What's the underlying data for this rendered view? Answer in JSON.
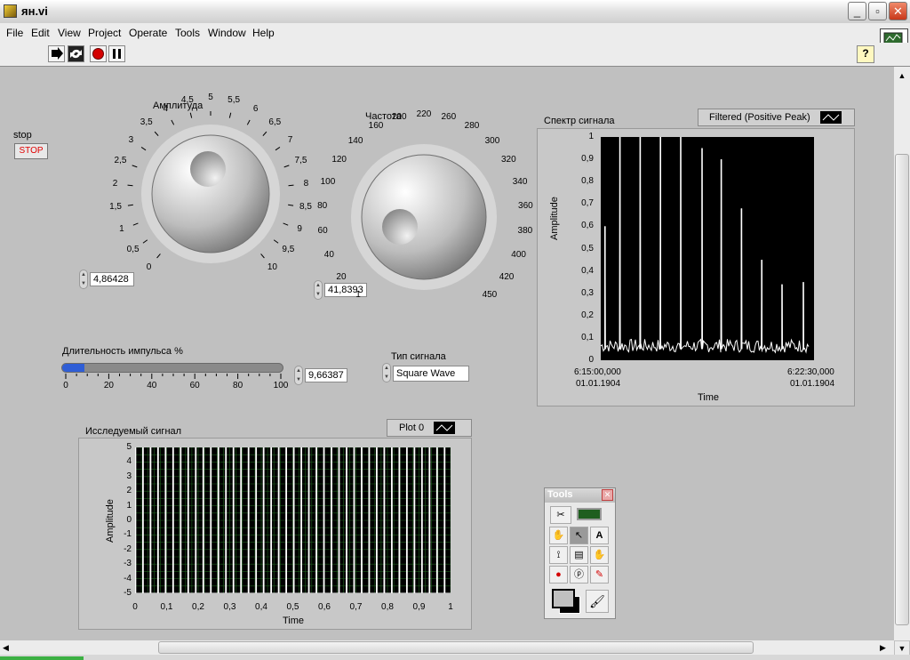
{
  "window": {
    "title": "ян.vi",
    "min_label": "_",
    "max_label": "▫",
    "close_label": "✕"
  },
  "menu": [
    "File",
    "Edit",
    "View",
    "Project",
    "Operate",
    "Tools",
    "Window",
    "Help"
  ],
  "help_label": "?",
  "stop": {
    "label": "stop",
    "button": "STOP"
  },
  "amplitude": {
    "label": "Амплитуда",
    "value": "4,86428",
    "scale": [
      "0",
      "0,5",
      "1",
      "1,5",
      "2",
      "2,5",
      "3",
      "3,5",
      "4",
      "4,5",
      "5",
      "5,5",
      "6",
      "6,5",
      "7",
      "7,5",
      "8",
      "8,5",
      "9",
      "9,5",
      "10"
    ]
  },
  "frequency": {
    "label": "Частота",
    "value": "41,8393",
    "scale": [
      "1",
      "20",
      "40",
      "60",
      "80",
      "100",
      "120",
      "140",
      "160",
      "200",
      "220",
      "260",
      "280",
      "300",
      "320",
      "340",
      "360",
      "380",
      "400",
      "420",
      "450"
    ]
  },
  "pulse": {
    "label": "Длительность импульса %",
    "value": "9,66387",
    "fill": 0.1,
    "ticks": [
      "0",
      "20",
      "40",
      "60",
      "80",
      "100"
    ]
  },
  "signal_type": {
    "label": "Тип сигнала",
    "value": "Square Wave"
  },
  "spectrum": {
    "label": "Спектр сигнала",
    "legend": "Filtered (Positive Peak)",
    "ylabel": "Amplitude",
    "xlabel": "Time",
    "yticks": [
      "1",
      "0,9",
      "0,8",
      "0,7",
      "0,6",
      "0,5",
      "0,4",
      "0,3",
      "0,2",
      "0,1",
      "0"
    ],
    "x_start": [
      "6:15:00,000",
      "01.01.1904"
    ],
    "x_end": [
      "6:22:30,000",
      "01.01.1904"
    ]
  },
  "waveform": {
    "label": "Исследуемый сигнал",
    "legend": "Plot 0",
    "ylabel": "Amplitude",
    "xlabel": "Time",
    "yticks": [
      "5",
      "4",
      "3",
      "2",
      "1",
      "0",
      "-1",
      "-2",
      "-3",
      "-4",
      "-5"
    ],
    "xticks": [
      "0",
      "0,1",
      "0,2",
      "0,3",
      "0,4",
      "0,5",
      "0,6",
      "0,7",
      "0,8",
      "0,9",
      "1"
    ]
  },
  "tools_palette": {
    "title": "Tools",
    "close_label": "✕"
  },
  "colors": {
    "plot_bg": "#000000",
    "trace": "#ffffff",
    "grid": "#1f5e1f",
    "slider_fill": "#2f5ed6",
    "stop_text": "#e00000"
  },
  "chart_data": [
    {
      "type": "line",
      "title": "Спектр сигнала",
      "series": [
        {
          "name": "Filtered (Positive Peak)",
          "peaks": [
            {
              "x": 0.02,
              "y": 0.6
            },
            {
              "x": 0.09,
              "y": 1.0
            },
            {
              "x": 0.185,
              "y": 1.0
            },
            {
              "x": 0.28,
              "y": 1.0
            },
            {
              "x": 0.375,
              "y": 1.0
            },
            {
              "x": 0.475,
              "y": 0.95
            },
            {
              "x": 0.565,
              "y": 0.9
            },
            {
              "x": 0.66,
              "y": 0.68
            },
            {
              "x": 0.755,
              "y": 0.45
            },
            {
              "x": 0.85,
              "y": 0.34
            },
            {
              "x": 0.95,
              "y": 0.35
            }
          ],
          "baseline": 0.05
        }
      ],
      "xlabel": "Time",
      "ylabel": "Amplitude",
      "ylim": [
        0,
        1
      ],
      "grid": false,
      "legend": "top-right"
    },
    {
      "type": "line",
      "title": "Исследуемый сигнал",
      "series": [
        {
          "name": "Plot 0",
          "shape": "square",
          "high": 5,
          "low": -5,
          "duty": 0.0966,
          "frequency": 41.8393
        }
      ],
      "xlabel": "Time",
      "ylabel": "Amplitude",
      "xlim": [
        0,
        1
      ],
      "ylim": [
        -5,
        5
      ],
      "grid": true,
      "legend": "top-right"
    }
  ]
}
